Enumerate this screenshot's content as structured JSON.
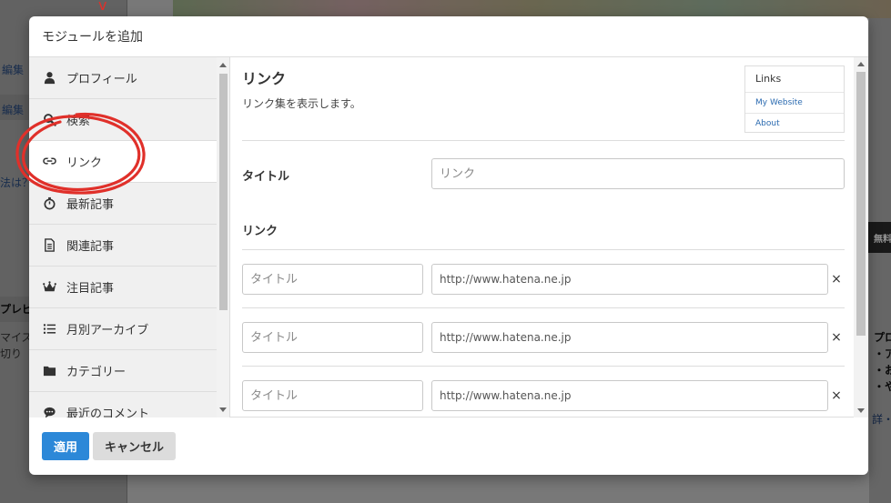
{
  "background": {
    "edit_labels": [
      "編集",
      "編集"
    ],
    "left_texts": [
      "法は？",
      "マイズ",
      "切り"
    ],
    "preview_label": "プレビ",
    "right_texts": [
      "プロ",
      "・ア",
      "・お",
      "・や"
    ],
    "right_dark_text": "無料",
    "bottom_right_link": "詳・"
  },
  "modal": {
    "title": "モジュールを追加",
    "modules": [
      {
        "label": "プロフィール",
        "icon": "user-icon"
      },
      {
        "label": "検索",
        "icon": "search-icon"
      },
      {
        "label": "リンク",
        "icon": "link-icon",
        "active": true
      },
      {
        "label": "最新記事",
        "icon": "stopwatch-icon"
      },
      {
        "label": "関連記事",
        "icon": "document-icon"
      },
      {
        "label": "注目記事",
        "icon": "crown-icon"
      },
      {
        "label": "月別アーカイブ",
        "icon": "list-icon"
      },
      {
        "label": "カテゴリー",
        "icon": "folder-icon"
      },
      {
        "label": "最近のコメント",
        "icon": "comment-icon"
      }
    ],
    "detail": {
      "title": "リンク",
      "description": "リンク集を表示します。",
      "preview": {
        "title": "Links",
        "items": [
          "My Website",
          "About"
        ]
      },
      "title_field_label": "タイトル",
      "title_field_placeholder": "リンク",
      "links_label": "リンク",
      "link_rows": [
        {
          "title_placeholder": "タイトル",
          "url_placeholder": "http://www.hatena.ne.jp"
        },
        {
          "title_placeholder": "タイトル",
          "url_placeholder": "http://www.hatena.ne.jp"
        },
        {
          "title_placeholder": "タイトル",
          "url_placeholder": "http://www.hatena.ne.jp"
        }
      ],
      "remove_symbol": "×"
    },
    "footer": {
      "apply_label": "適用",
      "cancel_label": "キャンセル"
    }
  },
  "colors": {
    "apply_button": "#2c88d8",
    "annotation_red": "#e0302a"
  }
}
